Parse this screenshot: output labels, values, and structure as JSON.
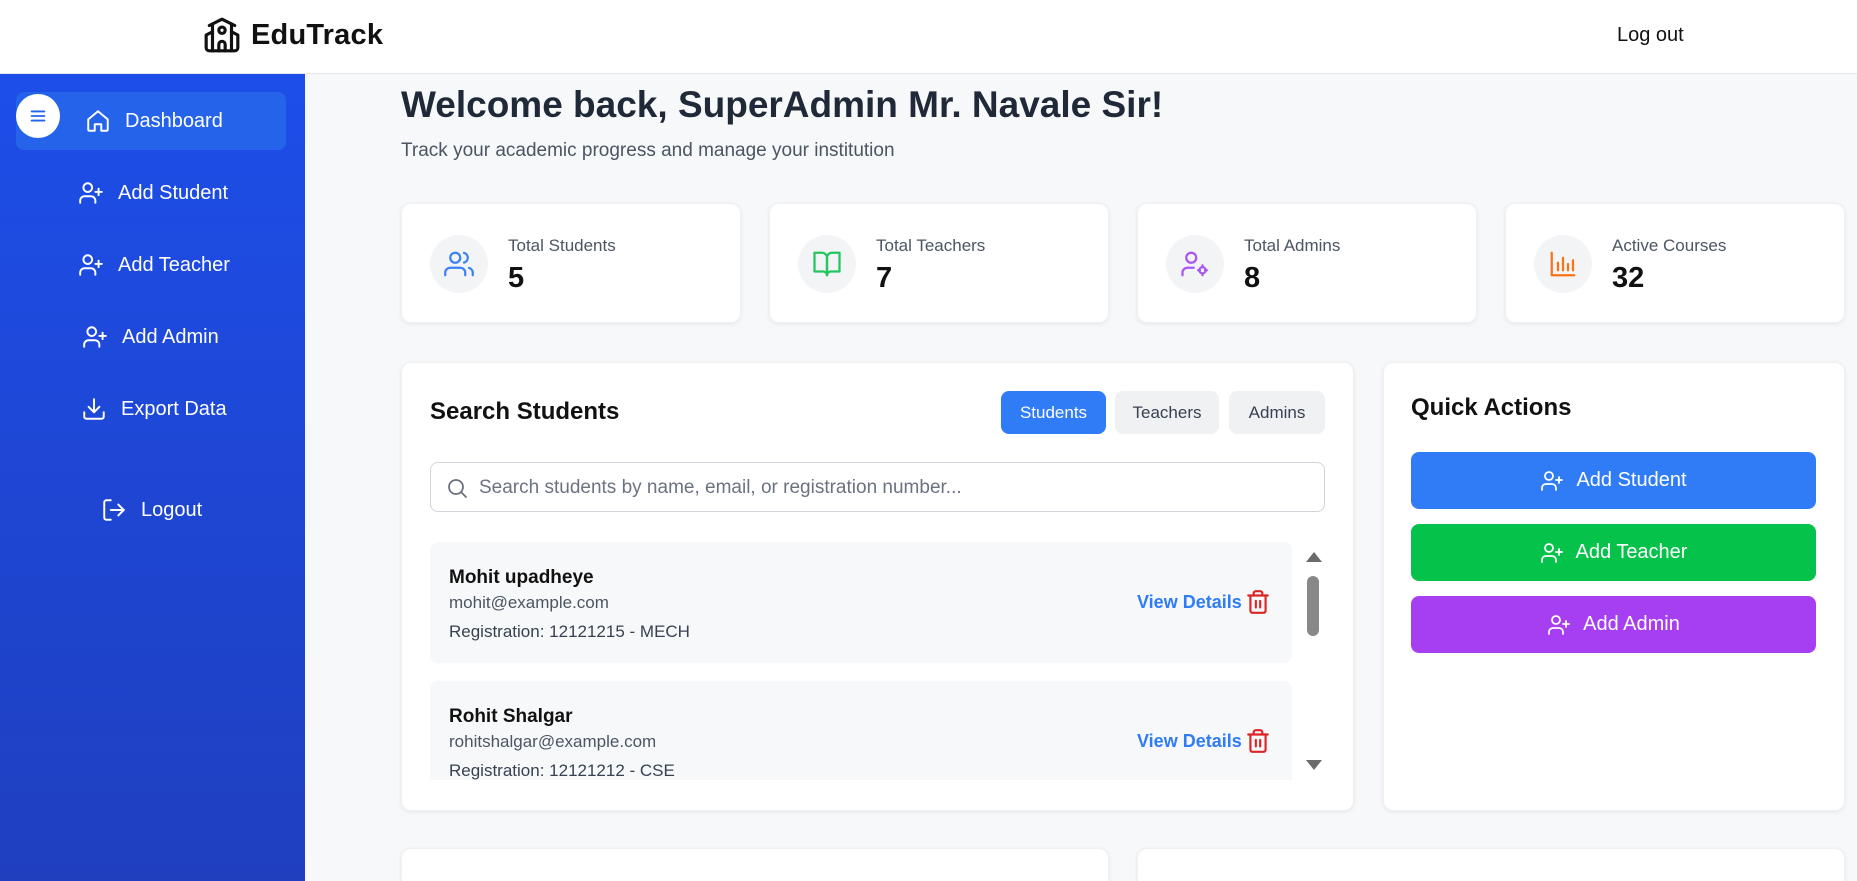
{
  "app": {
    "brand": "EduTrack",
    "logout_label": "Log out"
  },
  "sidebar": {
    "items": [
      {
        "label": "Dashboard",
        "icon": "home-icon"
      },
      {
        "label": "Add Student",
        "icon": "user-plus-icon"
      },
      {
        "label": "Add Teacher",
        "icon": "user-plus-icon"
      },
      {
        "label": "Add Admin",
        "icon": "user-plus-icon"
      },
      {
        "label": "Export Data",
        "icon": "download-icon"
      },
      {
        "label": "Logout",
        "icon": "logout-icon"
      }
    ]
  },
  "header": {
    "welcome": "Welcome back, SuperAdmin Mr. Navale Sir!",
    "subtitle": "Track your academic progress and manage your institution"
  },
  "stats": [
    {
      "label": "Total Students",
      "value": "5",
      "icon": "users-icon",
      "color": "#3b82f6"
    },
    {
      "label": "Total Teachers",
      "value": "7",
      "icon": "book-open-icon",
      "color": "#22c55e"
    },
    {
      "label": "Total Admins",
      "value": "8",
      "icon": "user-cog-icon",
      "color": "#a855f7"
    },
    {
      "label": "Active Courses",
      "value": "32",
      "icon": "bar-chart-icon",
      "color": "#f97316"
    }
  ],
  "search": {
    "title": "Search Students",
    "tabs": [
      "Students",
      "Teachers",
      "Admins"
    ],
    "placeholder": "Search students by name, email, or registration number...",
    "view_label": "View Details",
    "results": [
      {
        "name": "Mohit upadheye",
        "email": "mohit@example.com",
        "registration": "Registration: 12121215 - MECH"
      },
      {
        "name": "Rohit Shalgar",
        "email": "rohitshalgar@example.com",
        "registration": "Registration: 12121212 - CSE"
      }
    ]
  },
  "quick_actions": {
    "title": "Quick Actions",
    "buttons": [
      {
        "label": "Add Student",
        "color": "#2f7cf6"
      },
      {
        "label": "Add Teacher",
        "color": "#05c24a"
      },
      {
        "label": "Add Admin",
        "color": "#a63ef2"
      }
    ]
  }
}
